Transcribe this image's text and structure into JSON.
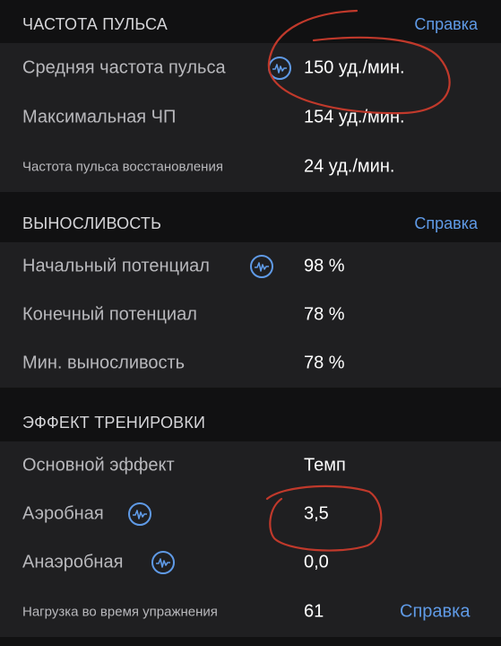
{
  "heart_rate": {
    "title": "ЧАСТОТА ПУЛЬСА",
    "help": "Справка",
    "rows": [
      {
        "label": "Средняя частота пульса",
        "value": "150 уд./мин."
      },
      {
        "label": "Максимальная ЧП",
        "value": "154 уд./мин."
      },
      {
        "label": "Частота пульса восстановления",
        "value": "24 уд./мин."
      }
    ]
  },
  "stamina": {
    "title": "ВЫНОСЛИВОСТЬ",
    "help": "Справка",
    "rows": [
      {
        "label": "Начальный потенциал",
        "value": "98 %"
      },
      {
        "label": "Конечный потенциал",
        "value": "78 %"
      },
      {
        "label": "Мин. выносливость",
        "value": "78 %"
      }
    ]
  },
  "training_effect": {
    "title": "ЭФФЕКТ ТРЕНИРОВКИ",
    "rows": [
      {
        "label": "Основной эффект",
        "value": "Темп"
      },
      {
        "label": "Аэробная",
        "value": "3,5"
      },
      {
        "label": "Анаэробная",
        "value": "0,0"
      },
      {
        "label": "Нагрузка во время упражнения",
        "value": "61",
        "help": "Справка"
      }
    ]
  },
  "icons": {
    "metric_info": "heart-rate-graph-icon"
  },
  "colors": {
    "background": "#111112",
    "card": "#1f1f21",
    "accent": "#5f9ae6",
    "annotation": "#c0392b"
  }
}
